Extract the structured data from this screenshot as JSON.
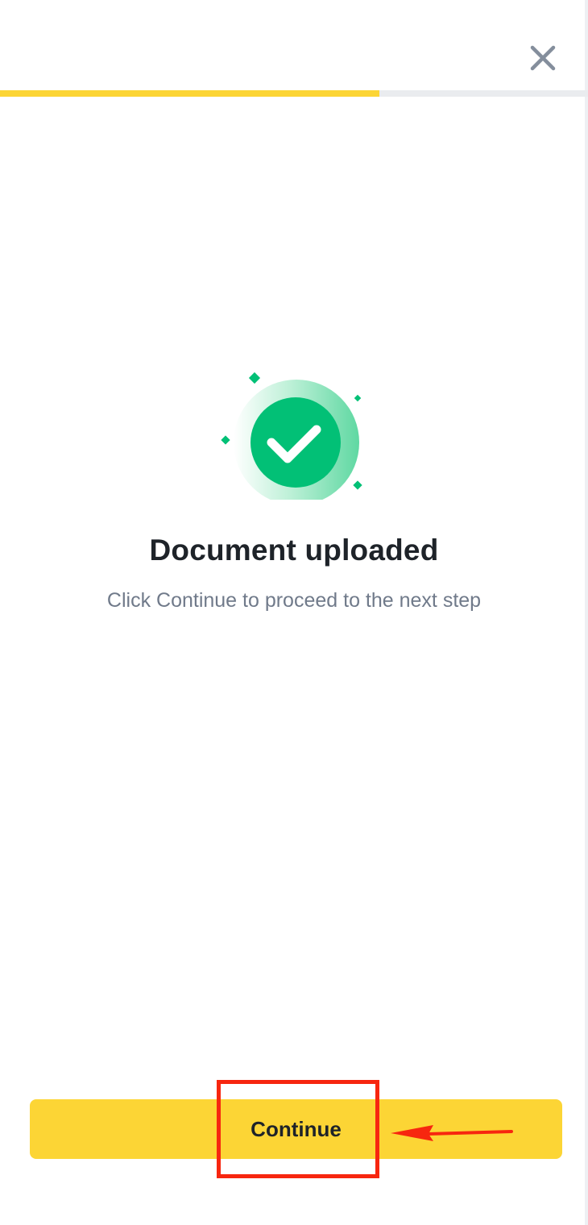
{
  "header": {
    "close_icon": "close-icon"
  },
  "progress": {
    "fraction": 0.645,
    "fill_color": "#fcd535",
    "track_color": "#eaecef"
  },
  "status": {
    "icon": "check-circle-icon",
    "accent_color": "#02c076",
    "title": "Document uploaded",
    "subtitle": "Click Continue to proceed to the next step"
  },
  "footer": {
    "continue_label": "Continue",
    "button_color": "#fcd535"
  },
  "annotation": {
    "color": "#f7260f",
    "arrow_icon": "arrow-left-icon"
  }
}
